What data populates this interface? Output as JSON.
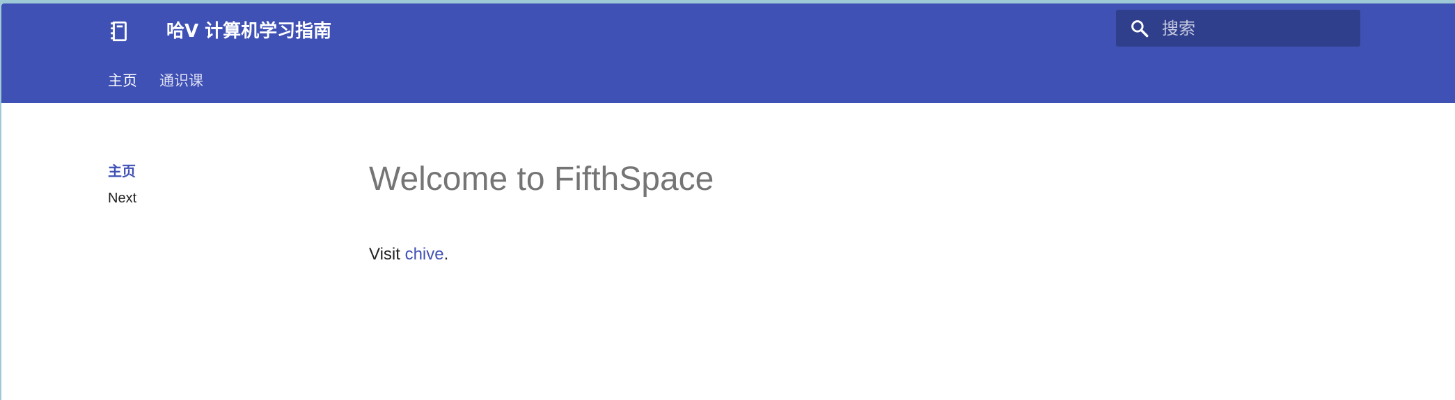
{
  "header": {
    "logo_icon": "notebook-icon",
    "title": "哈V 计算机学习指南",
    "background_color": "#3f51b5",
    "search": {
      "icon": "search-icon",
      "placeholder": "搜索"
    }
  },
  "tabs": [
    {
      "label": "主页",
      "active": true
    },
    {
      "label": "通识课",
      "active": false
    }
  ],
  "sidebar": {
    "items": [
      {
        "label": "主页",
        "active": true
      },
      {
        "label": "Next",
        "active": false
      }
    ]
  },
  "content": {
    "title": "Welcome to FifthSpace",
    "paragraph_prefix": "Visit ",
    "link_text": "chive",
    "paragraph_suffix": "."
  },
  "colors": {
    "accent": "#3f51b5",
    "search_background": "#303f8c",
    "title_text": "#757575",
    "body_text": "#222222"
  }
}
